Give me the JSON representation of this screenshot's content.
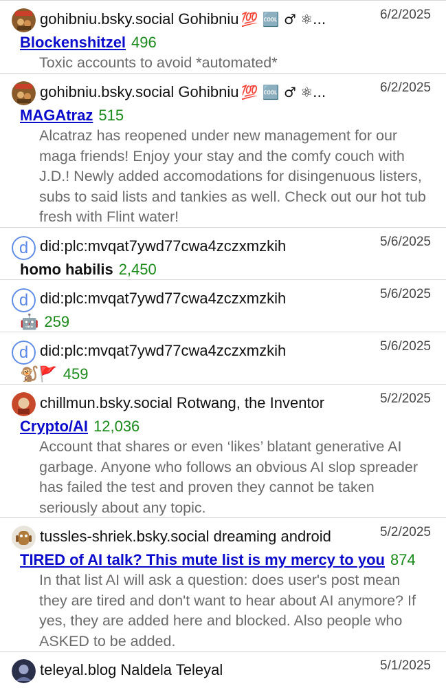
{
  "items": [
    {
      "handle_line": "gohibniu.bsky.social Gohibniu",
      "head_emoji": "💯 🆒 ♂ ⚛...",
      "date": "6/2/2025",
      "title": "Blockenshitzel",
      "count": "496",
      "description": "Toxic accounts to avoid *automated*"
    },
    {
      "handle_line": "gohibniu.bsky.social Gohibniu",
      "head_emoji": "💯 🆒 ♂ ⚛...",
      "date": "6/2/2025",
      "title": "MAGAtraz",
      "count": "515",
      "description": "Alcatraz has reopened under new management for our maga friends! Enjoy your stay and the comfy couch with J.D.! Newly added accomodations for disingenuous listers, subs to said lists and tankies as well. Check out our hot tub fresh with Flint water!"
    },
    {
      "handle_line": "did:plc:mvqat7ywd77cwa4zczxmzkih",
      "avatar_letter": "d",
      "date": "5/6/2025",
      "title": "homo habilis",
      "count": "2,450"
    },
    {
      "handle_line": "did:plc:mvqat7ywd77cwa4zczxmzkih",
      "avatar_letter": "d",
      "date": "5/6/2025",
      "title": "🤖",
      "count": "259"
    },
    {
      "handle_line": "did:plc:mvqat7ywd77cwa4zczxmzkih",
      "avatar_letter": "d",
      "date": "5/6/2025",
      "title": "🐒🚩",
      "count": "459"
    },
    {
      "handle_line": "chillmun.bsky.social Rotwang, the Inventor",
      "date": "5/2/2025",
      "title": "Crypto/AI",
      "count": "12,036",
      "description": "Account that shares or even ‘likes’ blatant generative AI garbage. Anyone who follows an obvious AI slop spreader has failed the test and proven they cannot be taken seriously about any topic."
    },
    {
      "handle_line": "tussles-shriek.bsky.social dreaming android",
      "date": "5/2/2025",
      "title": "TIRED of AI talk? This mute list is my mercy to you",
      "count": "874",
      "description": "In that list AI will ask a question: does user's post mean they are tired and don't want to hear about AI anymore? If yes, they are added here and blocked. Also people who ASKED to be added."
    },
    {
      "handle_line": "teleyal.blog Naldela Teleyal",
      "date": "5/1/2025"
    }
  ],
  "colors": {
    "link": "#0b0bcc",
    "count": "#1a8a1a",
    "description": "#6a6a6a",
    "did_avatar": "#5b8ae6",
    "divider": "#d6d6d6"
  },
  "icons": {
    "avatar_gohibniu": "gohibniu-avatar-icon",
    "avatar_did": "did-letter-avatar-icon",
    "avatar_chillmun": "chillmun-avatar-icon",
    "avatar_tussles": "android-avatar-icon",
    "avatar_teleyal": "teleyal-avatar-icon"
  }
}
